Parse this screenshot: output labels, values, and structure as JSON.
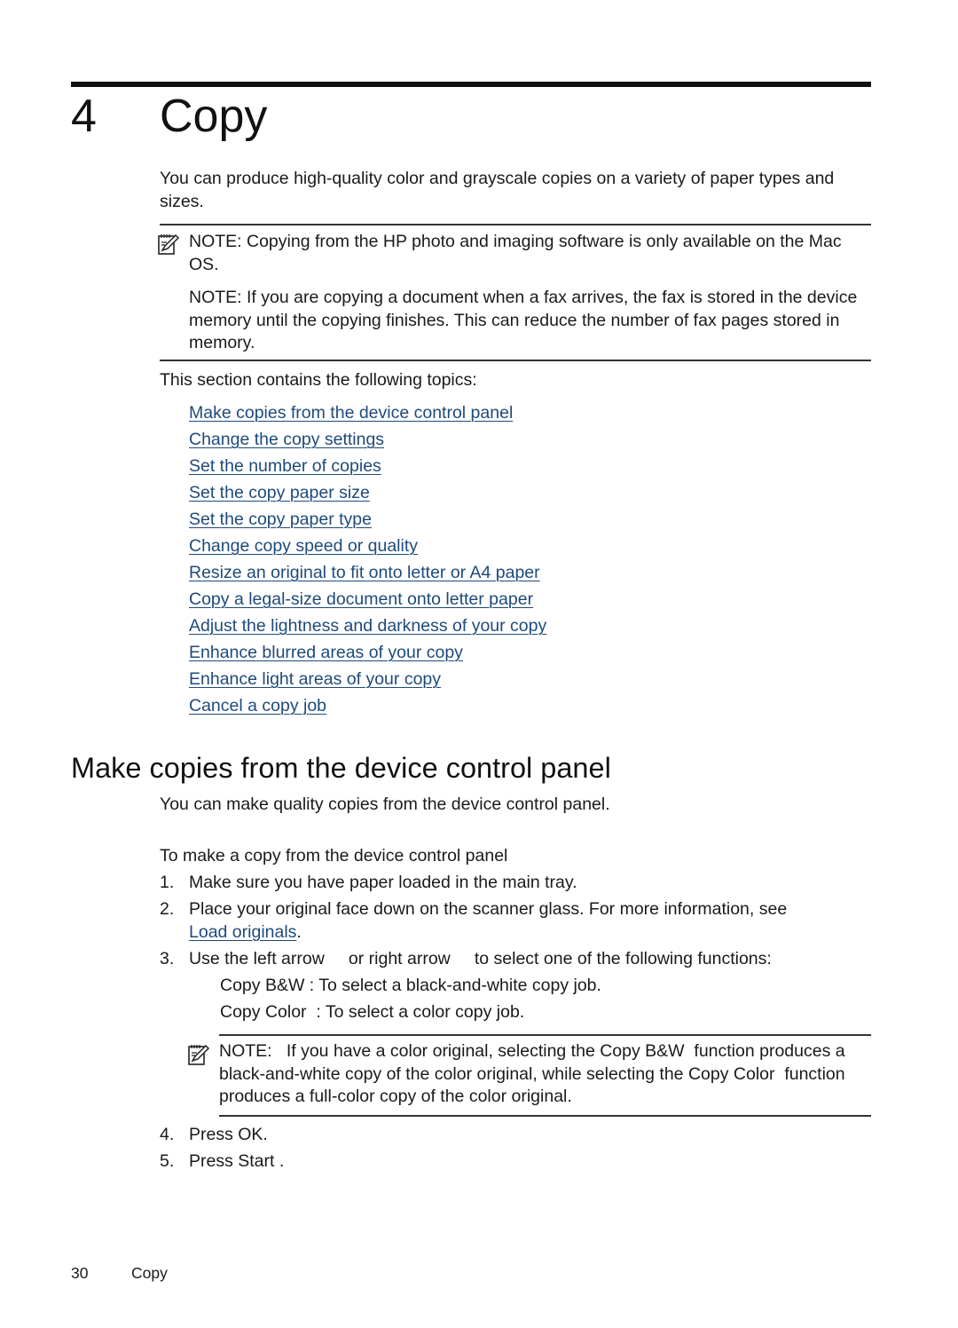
{
  "chapter": {
    "number": "4",
    "title": "Copy",
    "intro": "You can produce high-quality color and grayscale copies on a variety of paper types and sizes."
  },
  "notes_top": [
    {
      "icon": "note-pencil-icon",
      "text": "NOTE:   Copying from the HP photo and imaging software is only available on the Mac OS."
    },
    {
      "text": "NOTE:   If you are copying a document when a fax arrives, the fax is stored in the device memory until the copying finishes. This can reduce the number of fax pages stored in memory."
    }
  ],
  "topics": {
    "intro": "This section contains the following topics:",
    "links": [
      "Make copies from the device control panel",
      "Change the copy settings",
      "Set the number of copies",
      "Set the copy paper size",
      "Set the copy paper type",
      "Change copy speed or quality",
      "Resize an original to fit onto letter or A4 paper",
      "Copy a legal-size document onto letter paper",
      "Adjust the lightness and darkness of your copy",
      "Enhance blurred areas of your copy",
      "Enhance light areas of your copy",
      "Cancel a copy job"
    ]
  },
  "section": {
    "heading": "Make copies from the device control panel",
    "intro": "You can make quality copies from the device control panel.",
    "procedure_title": "To make a copy from the device control panel",
    "steps": [
      {
        "num": "1.",
        "text": "Make sure you have paper loaded in the main tray."
      },
      {
        "num": "2.",
        "text": "Place your original face down on the scanner glass. For more information, see",
        "link": "Load originals",
        "after": "."
      },
      {
        "num": "3.",
        "text": "Use the left arrow     or right arrow     to select one of the following functions:"
      },
      {
        "num": "4.",
        "text": "Press OK."
      },
      {
        "num": "5.",
        "text": "Press Start ."
      }
    ],
    "functions": [
      "Copy B&W : To select a black-and-white copy job.",
      "Copy Color  : To select a color copy job."
    ],
    "note": {
      "icon": "note-pencil-icon",
      "text": "NOTE:   If you have a color original, selecting the Copy B&W  function produces a black-and-white copy of the color original, while selecting the Copy Color  function produces a full-color copy of the color original."
    }
  },
  "footer": {
    "page_number": "30",
    "section": "Copy"
  },
  "colors": {
    "link": "#1e4a7a",
    "text": "#1a1a1a"
  }
}
